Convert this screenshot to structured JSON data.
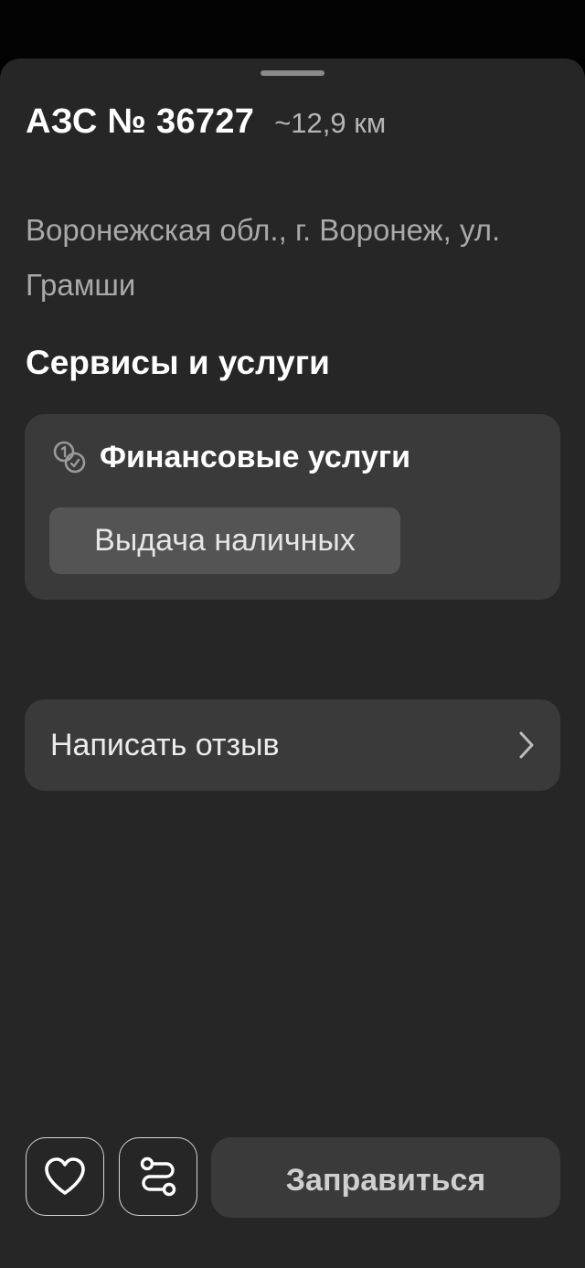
{
  "station": {
    "title": "АЗС № 36727",
    "distance": "~12,9 км",
    "address": "Воронежская обл., г. Воронеж, ул. Грамши"
  },
  "services": {
    "section_title": "Сервисы и услуги",
    "groups": [
      {
        "icon": "coins-icon",
        "title": "Финансовые услуги",
        "items": [
          "Выдача наличных"
        ]
      }
    ]
  },
  "review": {
    "label": "Написать отзыв",
    "icon": "chevron-right-icon"
  },
  "actions": {
    "favorite_icon": "heart-icon",
    "route_icon": "route-icon",
    "refuel_label": "Заправиться"
  }
}
